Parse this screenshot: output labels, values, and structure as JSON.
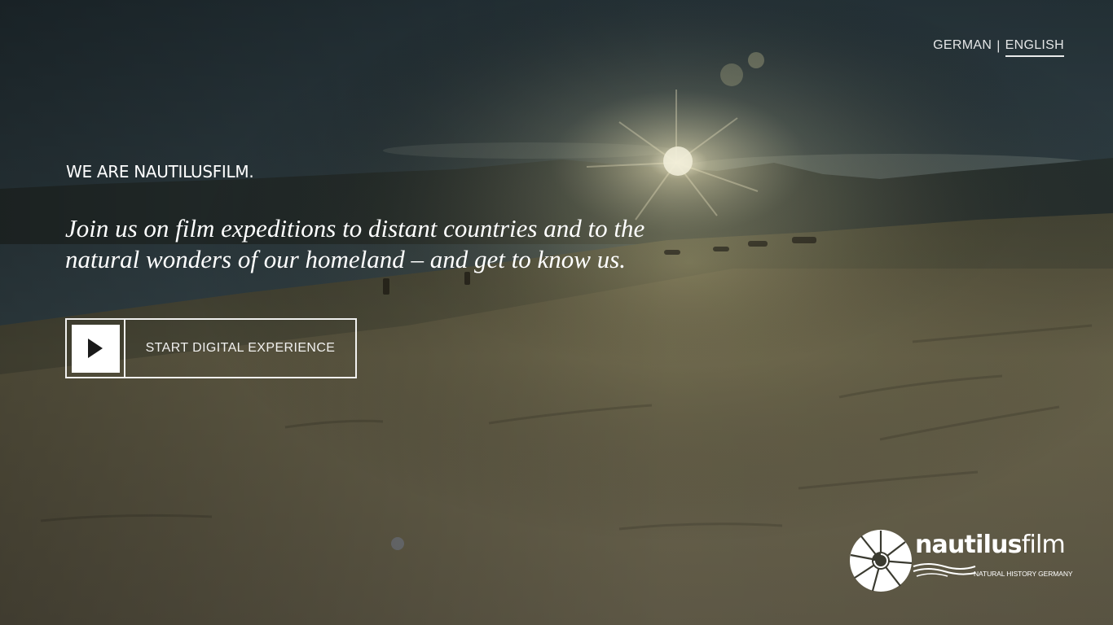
{
  "language_switch": {
    "german_label": "GERMAN",
    "separator": "|",
    "english_label": "ENGLISH",
    "active": "ENGLISH"
  },
  "hero": {
    "eyebrow": "WE ARE NAUTILUSFILM.",
    "headline": "Join us on film expeditions to distant countries and to the natural wonders of our homeland – and get to know us.",
    "cta_label": "START DIGITAL EXPERIENCE",
    "cta_icon": "play-icon"
  },
  "logo": {
    "name_bold": "nautilus",
    "name_light": "film",
    "tagline": "NATURAL HISTORY GERMANY",
    "icon": "nautilus-shell-icon"
  },
  "colors": {
    "text": "#ffffff",
    "sky": "#3b4a4f",
    "snow": "#7a7356"
  }
}
